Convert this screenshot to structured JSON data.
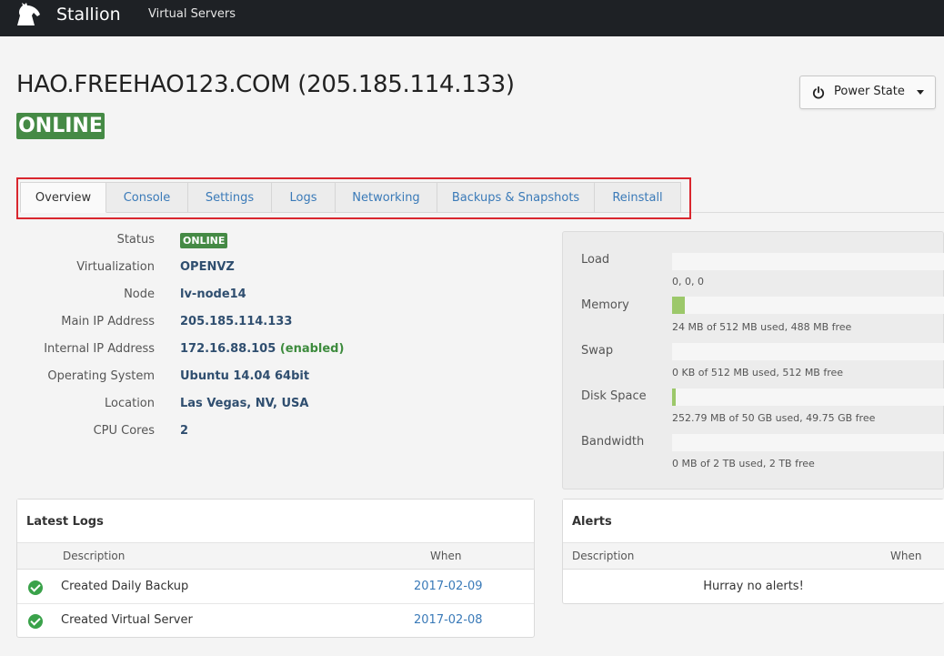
{
  "header": {
    "brand": "Stallion",
    "nav_link": "Virtual Servers"
  },
  "server": {
    "title": "HAO.FREEHAO123.COM (205.185.114.133)",
    "status_badge": "ONLINE",
    "power_button_label": "Power State"
  },
  "tabs": [
    {
      "label": "Overview",
      "active": true
    },
    {
      "label": "Console"
    },
    {
      "label": "Settings"
    },
    {
      "label": "Logs"
    },
    {
      "label": "Networking"
    },
    {
      "label": "Backups & Snapshots"
    },
    {
      "label": "Reinstall"
    }
  ],
  "info": {
    "status_label": "Status",
    "status_value": "ONLINE",
    "virtualization_label": "Virtualization",
    "virtualization_value": "OPENVZ",
    "node_label": "Node",
    "node_value": "lv-node14",
    "main_ip_label": "Main IP Address",
    "main_ip_value": "205.185.114.133",
    "internal_ip_label": "Internal IP Address",
    "internal_ip_value": "172.16.88.105",
    "internal_ip_state": "(enabled)",
    "os_label": "Operating System",
    "os_value": "Ubuntu 14.04 64bit",
    "location_label": "Location",
    "location_value": "Las Vegas, NV, USA",
    "cpu_label": "CPU Cores",
    "cpu_value": "2"
  },
  "usage": {
    "load": {
      "label": "Load",
      "text": "0, 0, 0",
      "fraction": 0
    },
    "memory": {
      "label": "Memory",
      "text": "24 MB of 512 MB used, 488 MB free",
      "fraction": 0.047
    },
    "swap": {
      "label": "Swap",
      "text": "0 KB of 512 MB used, 512 MB free",
      "fraction": 0
    },
    "disk": {
      "label": "Disk Space",
      "text": "252.79 MB of 50 GB used, 49.75 GB free",
      "fraction": 0.005
    },
    "bandwidth": {
      "label": "Bandwidth",
      "text": "0 MB of 2 TB used, 2 TB free",
      "fraction": 0
    },
    "fill_color": "#9cc86a"
  },
  "logs": {
    "title": "Latest Logs",
    "col_description": "Description",
    "col_when": "When",
    "rows": [
      {
        "description": "Created Daily Backup",
        "when": "2017-02-09"
      },
      {
        "description": "Created Virtual Server",
        "when": "2017-02-08"
      }
    ]
  },
  "alerts": {
    "title": "Alerts",
    "col_description": "Description",
    "col_when": "When",
    "empty_text": "Hurray no alerts!"
  },
  "colors": {
    "topbar": "#1e2125",
    "online_green": "#458a45",
    "link_blue": "#3a7ab8",
    "highlight_red": "#d9262e"
  }
}
